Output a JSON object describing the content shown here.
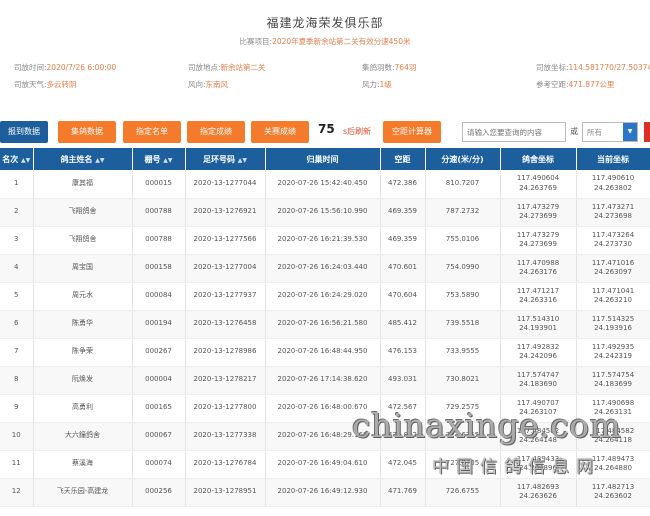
{
  "header": {
    "club_title": "福建龙海荣发俱乐部",
    "race_label": "比赛项目:",
    "race_value": "2020年夏季新余站第二关有效分速450米",
    "release_time_label": "司放时间:",
    "release_time": "2020/7/26 6:00:00",
    "release_location_label": "司放地点:",
    "release_location": "新余站第二关",
    "birds_count_label": "集鸽羽数:",
    "birds_count": "764羽",
    "release_coords_label": "司放坐标:",
    "release_coords": "114.581770/27.50374",
    "weather_label": "司放天气:",
    "weather": "多云转阴",
    "wind_dir_label": "风向:",
    "wind_dir": "东南风",
    "wind_level_label": "风力:",
    "wind_level": "1级",
    "ref_distance_label": "参考空距:",
    "ref_distance": "471.877公里"
  },
  "toolbar": {
    "report_btn": "报到数据",
    "collect_btn": "集鸽数据",
    "nominate_btn": "指定名单",
    "nominate_result_btn": "指定成绩",
    "follow_btn": "关赛成绩",
    "refresh_count": "75",
    "refresh_text": "s后刷新",
    "calculator_btn": "空距计算器",
    "search_placeholder": "请输入您要查询的内容",
    "or_label": "或",
    "select_value": "所有"
  },
  "table": {
    "headers": [
      "名次",
      "鸽主姓名",
      "棚号",
      "足环号码",
      "归巢时间",
      "空距",
      "分速(米/分)",
      "鸽舍坐标",
      "当前坐标"
    ],
    "rows": [
      [
        "1",
        "康其福",
        "000015",
        "2020-13-1277044",
        "2020-07-26 15:42:40.450",
        "472.386",
        "810.7207",
        "117.490604",
        "24.263769",
        "117.490610",
        "24.263802"
      ],
      [
        "2",
        "飞翔鸽舍",
        "000788",
        "2020-13-1276921",
        "2020-07-26 15:56:10.990",
        "469.359",
        "787.2732",
        "117.473279",
        "24.273699",
        "117.473271",
        "24.273698"
      ],
      [
        "3",
        "飞翔鸽舍",
        "000788",
        "2020-13-1277566",
        "2020-07-26 16:21:39.530",
        "469.359",
        "755.0106",
        "117.473279",
        "24.273699",
        "117.473264",
        "24.273730"
      ],
      [
        "4",
        "周宝国",
        "000158",
        "2020-13-1277004",
        "2020-07-26 16:24:03.440",
        "470.601",
        "754.0990",
        "117.470988",
        "24.263176",
        "117.471016",
        "24.263097"
      ],
      [
        "5",
        "周元水",
        "000084",
        "2020-13-1277937",
        "2020-07-26 16:24:29.020",
        "470.604",
        "753.5890",
        "117.471217",
        "24.263316",
        "117.471041",
        "24.263210"
      ],
      [
        "6",
        "陈勇华",
        "000194",
        "2020-13-1276458",
        "2020-07-26 16:56:21.580",
        "485.412",
        "739.5518",
        "117.514310",
        "24.193901",
        "117.514325",
        "24.193916"
      ],
      [
        "7",
        "陈争荣",
        "000267",
        "2020-13-1278986",
        "2020-07-26 16:48:44.950",
        "476.153",
        "733.9555",
        "117.492832",
        "24.242096",
        "117.492935",
        "24.242319"
      ],
      [
        "8",
        "阮焕发",
        "000004",
        "2020-13-1278217",
        "2020-07-26 17:14:38.620",
        "493.031",
        "730.8021",
        "117.574747",
        "24.183690",
        "117.574754",
        "24.183699"
      ],
      [
        "9",
        "高勇利",
        "000165",
        "2020-13-1277800",
        "2020-07-26 16:48:00.670",
        "472.567",
        "729.2575",
        "117.490707",
        "24.263107",
        "117.490698",
        "24.263131"
      ],
      [
        "10",
        "大六鐘鸽舍",
        "000067",
        "2020-13-1277338",
        "2020-07-26 16:48:29.160",
        "471.832",
        "727.6755",
        "117.484582",
        "24.264148",
        "117.484582",
        "24.264118"
      ],
      [
        "11",
        "蔡溪海",
        "000074",
        "2020-13-1276784",
        "2020-07-26 16:49:04.610",
        "472.045",
        "727.0705",
        "117.489433",
        "24.264896",
        "117.489473",
        "24.264880"
      ],
      [
        "12",
        "飞天乐园-高建龙",
        "000256",
        "2020-13-1278951",
        "2020-07-26 16:49:12.930",
        "471.769",
        "726.6755",
        "117.482693",
        "24.263626",
        "117.482713",
        "24.263602"
      ]
    ]
  },
  "watermark": {
    "domain": "chinaxinge.com",
    "cn": "中国信鸽信息网"
  }
}
